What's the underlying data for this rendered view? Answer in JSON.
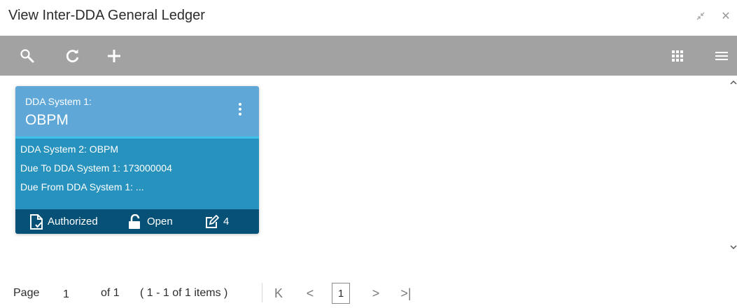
{
  "window": {
    "title": "View Inter-DDA General Ledger",
    "minimize_icon": "collapse-icon",
    "close_icon": "close-icon",
    "close_glyph": "✕"
  },
  "toolbar": {
    "icons": [
      "search-icon",
      "refresh-icon",
      "add-icon",
      "grid-view-icon",
      "list-view-icon"
    ]
  },
  "card": {
    "header_label": "DDA System 1:",
    "header_value": "OBPM",
    "rows": [
      "DDA System 2:  OBPM",
      "Due To DDA System 1:  173000004",
      "Due From DDA System 1:  ..."
    ],
    "footer": {
      "status": "Authorized",
      "record_status": "Open",
      "modification_count": "4"
    },
    "colors": {
      "header": "#5ea7d7",
      "separator": "#3dc3ea",
      "body": "#2792bd",
      "footer": "#075176"
    }
  },
  "pager": {
    "page_label": "Page",
    "page_value": "1",
    "of_label": "of 1",
    "items_summary": "( 1 - 1 of 1 items )",
    "first_glyph": "K",
    "prev_glyph": "<",
    "current_page": "1",
    "next_glyph": ">",
    "last_glyph": ">|"
  },
  "toolbar_color": "#a2a2a2"
}
